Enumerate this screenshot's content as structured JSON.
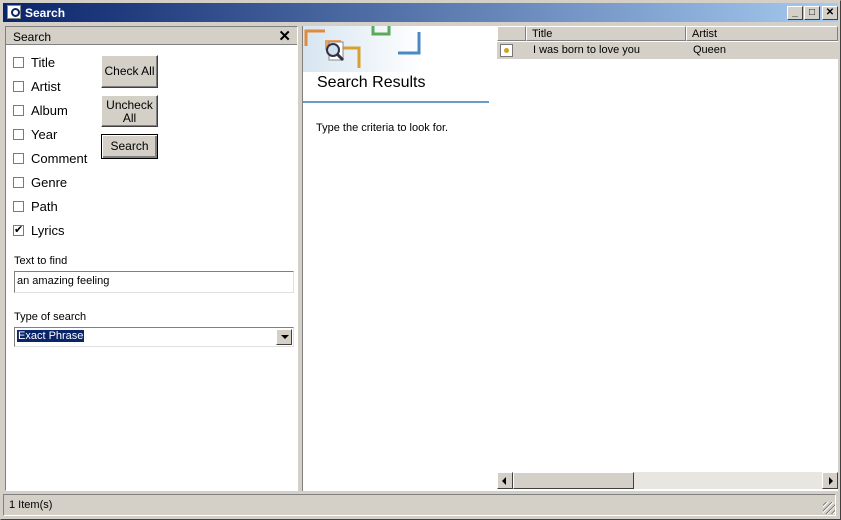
{
  "window": {
    "title": "Search"
  },
  "search_panel": {
    "header": "Search",
    "fields": [
      {
        "label": "Title",
        "checked": false
      },
      {
        "label": "Artist",
        "checked": false
      },
      {
        "label": "Album",
        "checked": false
      },
      {
        "label": "Year",
        "checked": false
      },
      {
        "label": "Comment",
        "checked": false
      },
      {
        "label": "Genre",
        "checked": false
      },
      {
        "label": "Path",
        "checked": false
      },
      {
        "label": "Lyrics",
        "checked": true
      }
    ],
    "buttons": {
      "check_all": "Check All",
      "uncheck_all_line1": "Uncheck",
      "uncheck_all_line2": "All",
      "search": "Search"
    },
    "text_to_find_label": "Text to find",
    "text_to_find_value": "an amazing feeling",
    "type_of_search_label": "Type of search",
    "type_of_search_value": "Exact Phrase"
  },
  "results_pane": {
    "title": "Search Results",
    "hint": "Type the criteria to look for."
  },
  "results_list": {
    "columns": [
      "Title",
      "Artist"
    ],
    "rows": [
      {
        "title": "I was born to love you",
        "artist": "Queen"
      }
    ]
  },
  "status": {
    "items": "1 Item(s)"
  },
  "colors": {
    "titlebar_start": "#0a246a",
    "titlebar_end": "#a6caf0",
    "selection": "#0a246a",
    "accent_line": "#6a9cc4"
  }
}
